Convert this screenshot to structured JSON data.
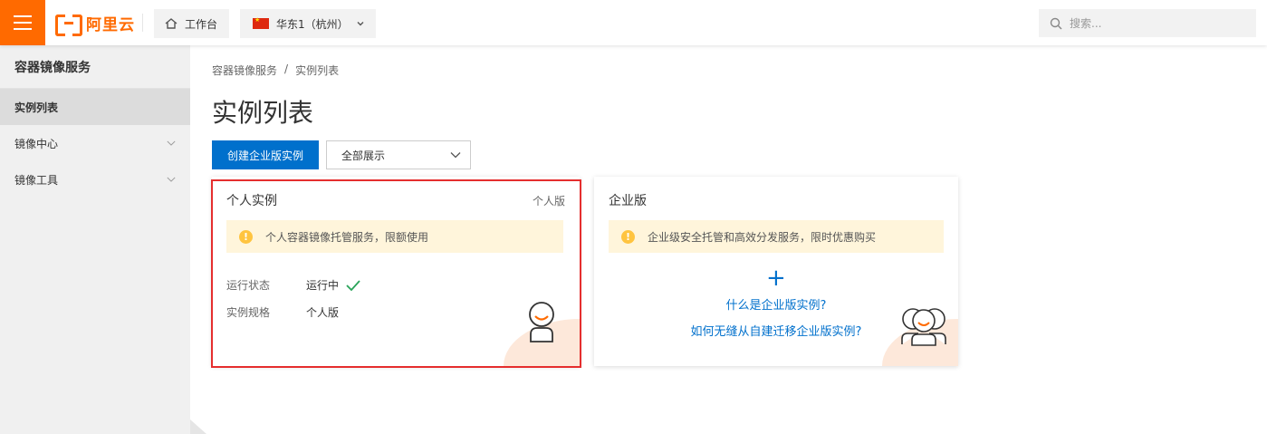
{
  "topbar": {
    "logo_text": "阿里云",
    "workbench_label": "工作台",
    "region_label": "华东1（杭州）",
    "search_placeholder": "搜索..."
  },
  "sidebar": {
    "title": "容器镜像服务",
    "items": [
      {
        "label": "实例列表",
        "active": true
      },
      {
        "label": "镜像中心",
        "expandable": true
      },
      {
        "label": "镜像工具",
        "expandable": true
      }
    ]
  },
  "main": {
    "breadcrumb": [
      "容器镜像服务",
      "/",
      "实例列表"
    ],
    "title": "实例列表",
    "create_button": "创建企业版实例",
    "filter_select": "全部展示",
    "cards": [
      {
        "title": "个人实例",
        "tag": "个人版",
        "notice": "个人容器镜像托管服务，限额使用",
        "status_label": "运行状态",
        "status_value": "运行中",
        "spec_label": "实例规格",
        "spec_value": "个人版"
      },
      {
        "title": "企业版",
        "notice": "企业级安全托管和高效分发服务，限时优惠购买",
        "plus": "+",
        "link1": "什么是企业版实例?",
        "link2": "如何无缝从自建迁移企业版实例?"
      }
    ]
  },
  "colors": {
    "brand": "#ff6a00",
    "primary": "#0070cc",
    "highlight": "#e52e2e",
    "notice_bg": "#fff5db",
    "success": "#2aa45a"
  }
}
